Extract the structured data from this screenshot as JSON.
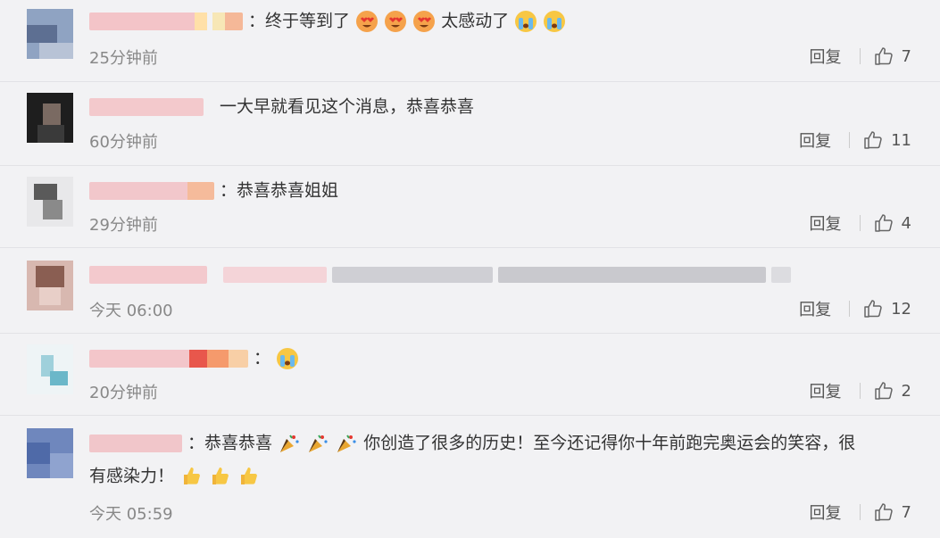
{
  "comments": [
    {
      "text": "：终于等到了",
      "text2": "太感动了",
      "time": "25分钟前",
      "reply": "回复",
      "likes": "7"
    },
    {
      "text": "一大早就看见这个消息，恭喜恭喜",
      "time": "60分钟前",
      "reply": "回复",
      "likes": "11"
    },
    {
      "text": "：恭喜恭喜姐姐",
      "time": "29分钟前",
      "reply": "回复",
      "likes": "4"
    },
    {
      "text": "",
      "time": "今天 06:00",
      "reply": "回复",
      "likes": "12"
    },
    {
      "text": "：",
      "time": "20分钟前",
      "reply": "回复",
      "likes": "2"
    },
    {
      "text": "：恭喜恭喜",
      "text2": "你创造了很多的历史！至今还记得你十年前跑完奥运会的笑容，很",
      "text3": "有感染力！",
      "time": "今天 05:59",
      "reply": "回复",
      "likes": "7"
    }
  ],
  "icons": {
    "heart_eyes": "heart-eyes-emoji",
    "crying": "crying-emoji",
    "party": "party-popper-emoji",
    "thumbs": "thumbs-up-emoji",
    "like": "thumb-up-outline-icon"
  }
}
